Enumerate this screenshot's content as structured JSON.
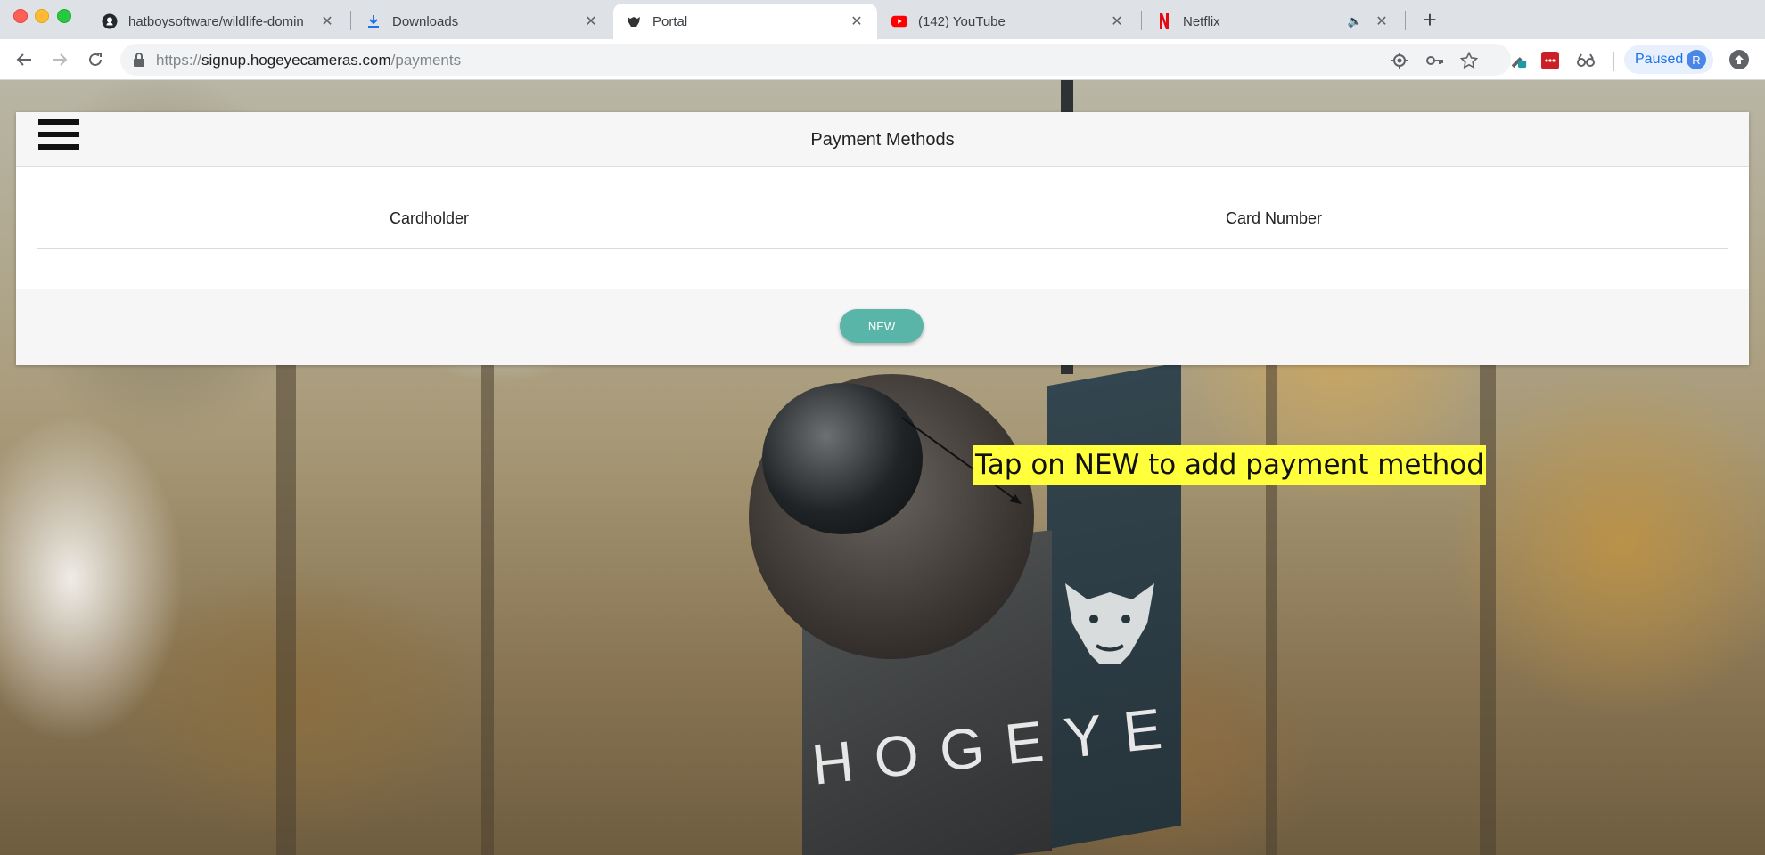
{
  "tabs": [
    {
      "title": "hatboysoftware/wildlife-domin",
      "icon": "github-icon",
      "active": false
    },
    {
      "title": "Downloads",
      "icon": "download-icon",
      "active": false
    },
    {
      "title": "Portal",
      "icon": "boar-icon",
      "active": true
    },
    {
      "title": "(142) YouTube",
      "icon": "youtube-icon",
      "active": false
    },
    {
      "title": "Netflix",
      "icon": "netflix-icon",
      "active": false,
      "muted": true
    }
  ],
  "toolbar": {
    "url_prefix": "https://",
    "url_host": "signup.hogeyecameras.com",
    "url_path": "/payments",
    "profile_status": "Paused",
    "profile_initial": "R"
  },
  "page": {
    "title": "Payment Methods",
    "columns": [
      "Cardholder",
      "Card Number"
    ],
    "rows": [],
    "new_button_label": "NEW"
  },
  "background": {
    "brand_text": "HOGEYE"
  },
  "annotation": {
    "text": "Tap on NEW to add payment method",
    "highlight_color": "#ffff3c"
  },
  "colors": {
    "accent_button": "#59b5a7",
    "profile_blue": "#1a73e8"
  }
}
